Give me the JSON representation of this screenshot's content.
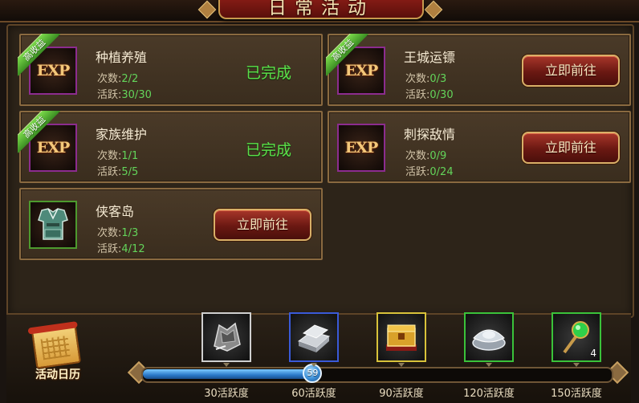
{
  "header": {
    "title": "日常活动"
  },
  "activities": [
    {
      "name": "种植养殖",
      "count_label": "次数:",
      "count_value": "2/2",
      "active_label": "活跃:",
      "active_value": "30/30",
      "badge": "高收益",
      "icon": "exp-icon",
      "status": "已完成"
    },
    {
      "name": "王城运镖",
      "count_label": "次数:",
      "count_value": "0/3",
      "active_label": "活跃:",
      "active_value": "0/30",
      "badge": "高收益",
      "icon": "exp-icon",
      "button": "立即前往"
    },
    {
      "name": "家族维护",
      "count_label": "次数:",
      "count_value": "1/1",
      "active_label": "活跃:",
      "active_value": "5/5",
      "badge": "高收益",
      "icon": "exp-icon",
      "status": "已完成"
    },
    {
      "name": "刺探敌情",
      "count_label": "次数:",
      "count_value": "0/9",
      "active_label": "活跃:",
      "active_value": "0/24",
      "icon": "exp-icon",
      "button": "立即前往"
    },
    {
      "name": "侠客岛",
      "count_label": "次数:",
      "count_value": "1/3",
      "active_label": "活跃:",
      "active_value": "4/12",
      "icon": "armor-icon",
      "button": "立即前往"
    }
  ],
  "calendar": {
    "label": "活动日历"
  },
  "progress": {
    "current": 59,
    "max": 150,
    "value_text": "59"
  },
  "rewards": [
    {
      "threshold": 30,
      "label": "30活跃度",
      "icon": "armor-set-icon",
      "border_color": "#cfcfcf"
    },
    {
      "threshold": 60,
      "label": "60活跃度",
      "icon": "iron-ingot-icon",
      "border_color": "#3a5ad8"
    },
    {
      "threshold": 90,
      "label": "90活跃度",
      "icon": "treasure-chest-icon",
      "border_color": "#d8c23a"
    },
    {
      "threshold": 120,
      "label": "120活跃度",
      "icon": "silver-ingot-icon",
      "border_color": "#3ac23a"
    },
    {
      "threshold": 150,
      "label": "150活跃度",
      "icon": "jade-scepter-icon",
      "border_color": "#3ac23a",
      "count": "4"
    }
  ],
  "colors": {
    "active_value": "#63d45a",
    "completed": "#5be04a",
    "button_red": "#8a2018",
    "progress_blue": "#2b79c9"
  }
}
